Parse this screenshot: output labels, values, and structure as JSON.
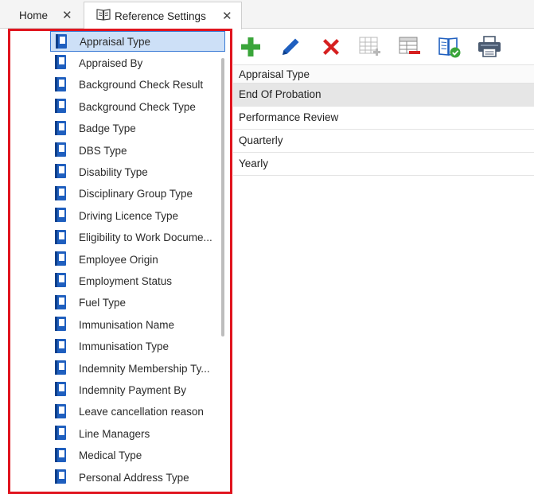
{
  "tabs": {
    "home_label": "Home",
    "ref_label": "Reference Settings",
    "close_glyph": "✕"
  },
  "tree": {
    "items": [
      "Appraisal Type",
      "Appraised By",
      "Background Check Result",
      "Background Check Type",
      "Badge Type",
      "DBS Type",
      "Disability Type",
      "Disciplinary Group Type",
      "Driving Licence Type",
      "Eligibility to Work Docume...",
      "Employee Origin",
      "Employment Status",
      "Fuel Type",
      "Immunisation Name",
      "Immunisation Type",
      "Indemnity Membership Ty...",
      "Indemnity Payment By",
      "Leave cancellation reason",
      "Line Managers",
      "Medical Type",
      "Personal Address Type"
    ],
    "selected_index": 0
  },
  "toolbar": {
    "buttons": [
      "add-icon",
      "edit-pencil-icon",
      "delete-icon",
      "add-column-icon",
      "remove-row-icon",
      "book-check-icon",
      "printer-icon"
    ]
  },
  "grid": {
    "header": "Appraisal Type",
    "rows": [
      "End Of Probation",
      "Performance Review",
      "Quarterly",
      "Yearly"
    ],
    "active_index": 0
  },
  "colors": {
    "accent_red": "#e0141e",
    "book_blue": "#1f5fbf",
    "add_green": "#3aa53a",
    "delete_red": "#d62020",
    "selected_bg": "#cde0f7"
  }
}
